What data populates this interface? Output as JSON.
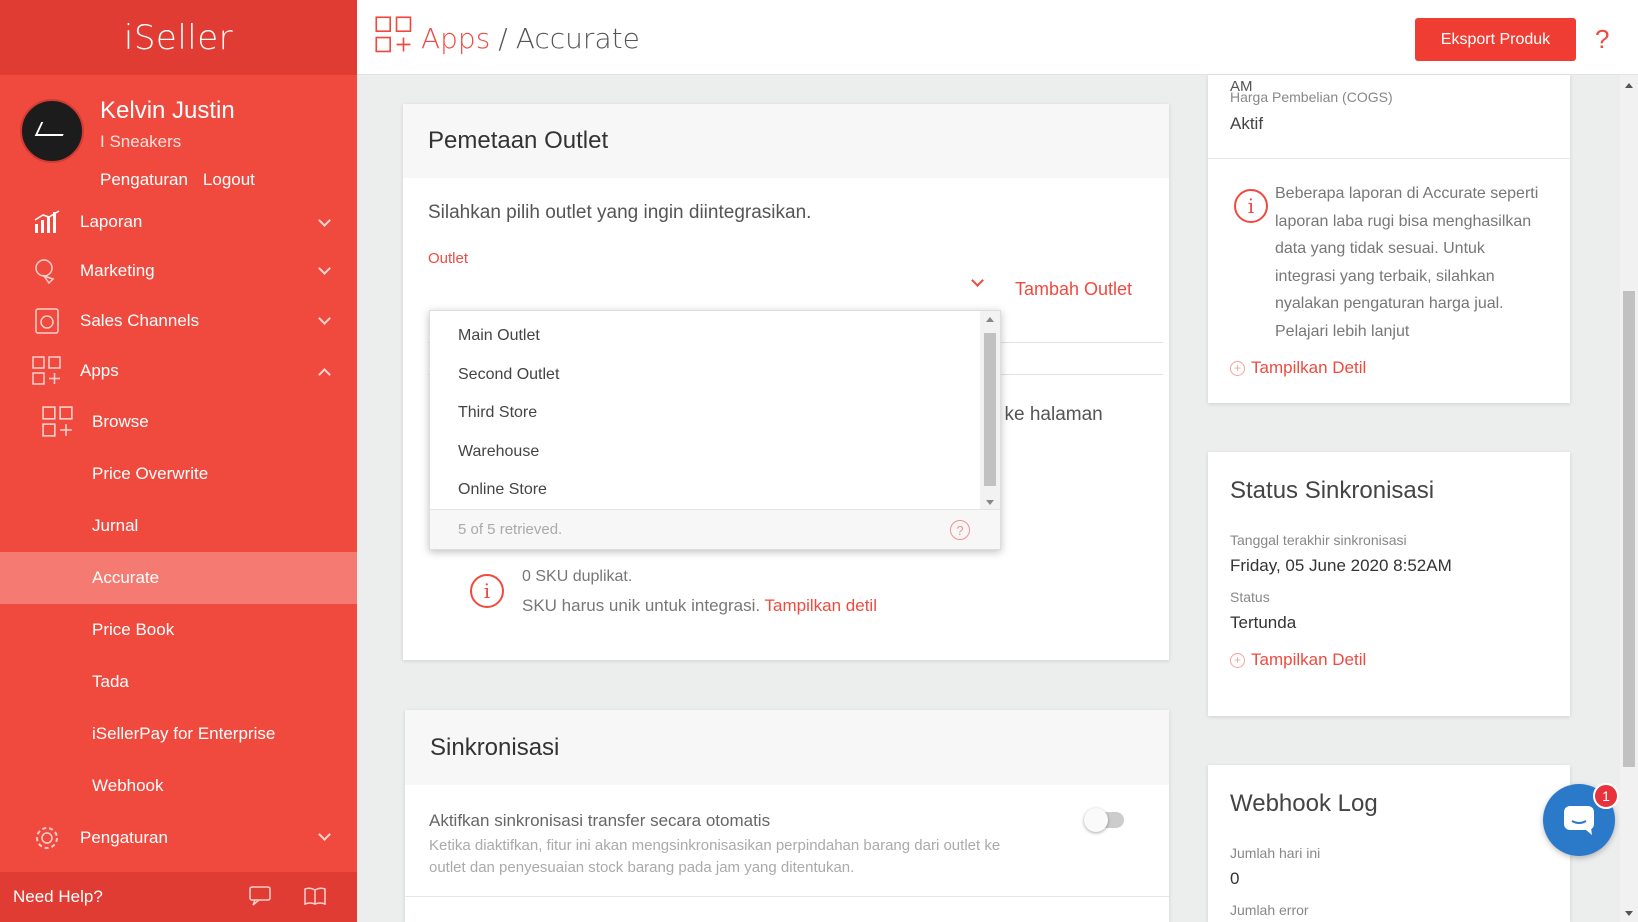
{
  "colors": {
    "accent": "#f04a3f",
    "sidebar": "#f04a3f",
    "active_item": "#f57b72",
    "chat": "#2b79c9"
  },
  "sidebar": {
    "logo": "iSeller",
    "user_name": "Kelvin Justin",
    "store_name": "I Sneakers",
    "settings_link": "Pengaturan",
    "logout_link": "Logout",
    "nav": {
      "laporan": "Laporan",
      "marketing": "Marketing",
      "sales_channels": "Sales Channels",
      "apps": "Apps",
      "browse": "Browse",
      "price_overwrite": "Price Overwrite",
      "jurnal": "Jurnal",
      "accurate": "Accurate",
      "price_book": "Price Book",
      "tada": "Tada",
      "iseller_pay": "iSellerPay for Enterprise",
      "webhook": "Webhook",
      "pengaturan": "Pengaturan"
    },
    "need_help": "Need Help?"
  },
  "header": {
    "breadcrumb_apps": "Apps",
    "breadcrumb_sep": "/",
    "breadcrumb_current": "Accurate",
    "export_button": "Eksport Produk",
    "help": "?"
  },
  "outlet_card": {
    "title": "Pemetaan Outlet",
    "description": "Silahkan pilih outlet yang ingin diintegrasikan.",
    "outlet_label": "Outlet",
    "add_outlet": "Tambah Outlet",
    "partial_text": "i ke halaman",
    "dropdown_options": [
      "Main Outlet",
      "Second Outlet",
      "Third Store",
      "Warehouse",
      "Online Store"
    ],
    "dropdown_footer": "5 of 5 retrieved.",
    "dropdown_help": "?",
    "duplicate_count": "0 SKU duplikat.",
    "duplicate_note": "SKU harus unik untuk integrasi.",
    "duplicate_link": "Tampilkan detil"
  },
  "sync_card": {
    "title": "Sinkronisasi",
    "auto_transfer_title": "Aktifkan sinkronisasi transfer secara otomatis",
    "auto_transfer_desc": "Ketika diaktifkan, fitur ini akan mengsinkronisasikan perpindahan barang dari outlet ke outlet dan penyesuaian stock barang pada jam yang ditentukan.",
    "auto_transfer_enabled": false
  },
  "info_card": {
    "am": "AM",
    "cogs_label": "Harga Pembelian (COGS)",
    "cogs_value": "Aktif",
    "warning_text": "Beberapa laporan di Accurate seperti laporan laba rugi bisa menghasilkan data yang tidak sesuai. Untuk integrasi yang terbaik, silahkan nyalakan pengaturan harga jual.",
    "learn_more": "Pelajari lebih lanjut",
    "show_detail": "Tampilkan Detil"
  },
  "status_card": {
    "title": "Status Sinkronisasi",
    "last_sync_label": "Tanggal terakhir sinkronisasi",
    "last_sync_value": "Friday, 05 June 2020 8:52AM",
    "status_label": "Status",
    "status_value": "Tertunda",
    "show_detail": "Tampilkan Detil"
  },
  "webhook_card": {
    "title": "Webhook Log",
    "today_label": "Jumlah hari ini",
    "today_value": "0",
    "error_label": "Jumlah error"
  },
  "chat": {
    "badge": "1"
  }
}
